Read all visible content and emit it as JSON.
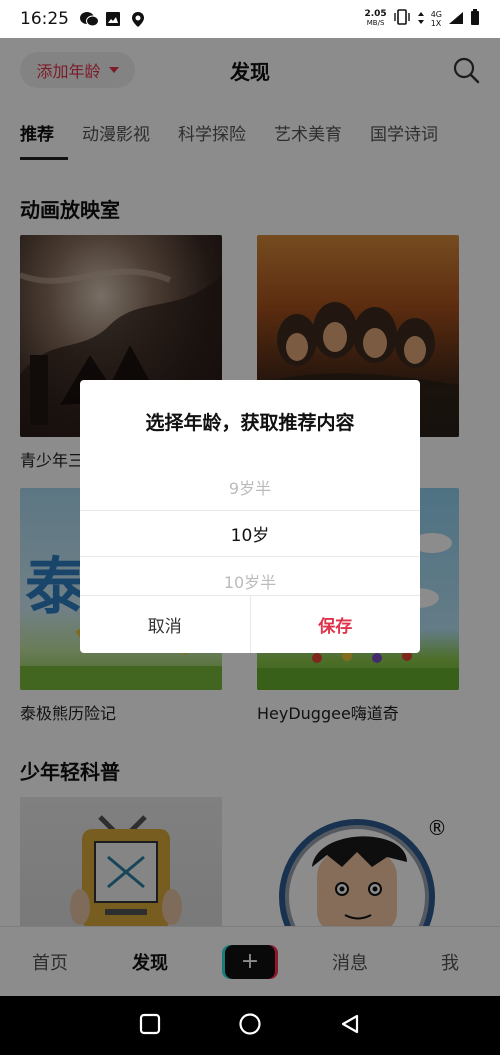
{
  "status_bar": {
    "time": "16:25",
    "net_speed": "2.05",
    "net_unit": "MB/S",
    "signal_label_top": "4G",
    "signal_label_bottom": "1X"
  },
  "header": {
    "age_button_label": "添加年龄",
    "title": "发现",
    "search_icon": "search-icon"
  },
  "tabs": [
    "推荐",
    "动漫影视",
    "科学探险",
    "艺术美育",
    "国学诗词"
  ],
  "sections": [
    {
      "title": "动画放映室",
      "cards": [
        {
          "caption": "青少年三国演义"
        },
        {
          "caption": ""
        },
        {
          "caption": "泰极熊历险记"
        },
        {
          "caption": "HeyDuggee嗨道奇"
        }
      ]
    },
    {
      "title": "少年轻科普",
      "cards": [
        {
          "caption": ""
        },
        {
          "caption": ""
        }
      ]
    }
  ],
  "bottom_nav": {
    "home": "首页",
    "discover": "发现",
    "plus": "+",
    "messages": "消息",
    "me": "我"
  },
  "dialog": {
    "title": "选择年龄，获取推荐内容",
    "options": [
      "9岁半",
      "10岁",
      "10岁半"
    ],
    "selected": "10岁",
    "cancel": "取消",
    "save": "保存"
  },
  "colors": {
    "accent": "#e0334a"
  }
}
